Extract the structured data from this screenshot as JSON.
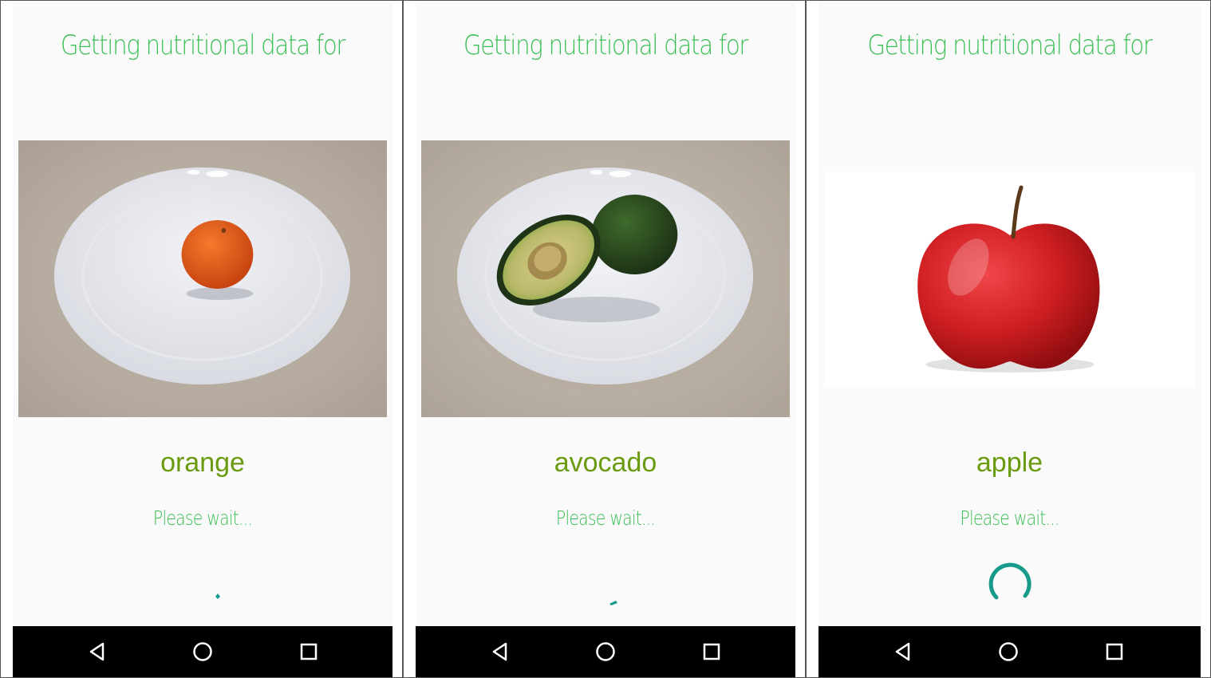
{
  "screens": [
    {
      "heading": "Getting nutritional data for",
      "food": "orange",
      "status": "Please wait...",
      "photo_icon": "orange-photo"
    },
    {
      "heading": "Getting nutritional data for",
      "food": "avocado",
      "status": "Please wait...",
      "photo_icon": "avocado-photo"
    },
    {
      "heading": "Getting nutritional data for",
      "food": "apple",
      "status": "Please wait...",
      "photo_icon": "apple-photo"
    }
  ],
  "navbar": {
    "icons": [
      "back-triangle-icon",
      "home-circle-icon",
      "recents-square-icon"
    ]
  },
  "colors": {
    "heading": "#3cbf55",
    "food_name": "#6a9a0e",
    "spinner": "#169a8a",
    "navbar": "#000000"
  }
}
